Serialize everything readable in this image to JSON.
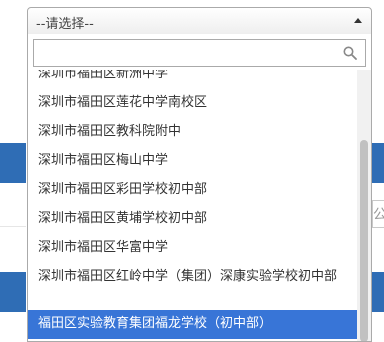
{
  "select": {
    "value": "--请选择--"
  },
  "search": {
    "value": "",
    "placeholder": ""
  },
  "options": [
    "深圳市福田区新洲中学",
    "深圳市福田区莲花中学南校区",
    "深圳市福田区教科院附中",
    "深圳市福田区梅山中学",
    "深圳市福田区彩田学校初中部",
    "深圳市福田区黄埔学校初中部",
    "深圳市福田区华富中学",
    "深圳市福田区红岭中学（集团）深康实验学校初中部",
    "福田区实验教育集团福龙学校（初中部）"
  ],
  "background": {
    "input_fragment": "公"
  },
  "colors": {
    "highlight": "#3875d7",
    "page_band": "#2f6db5"
  }
}
